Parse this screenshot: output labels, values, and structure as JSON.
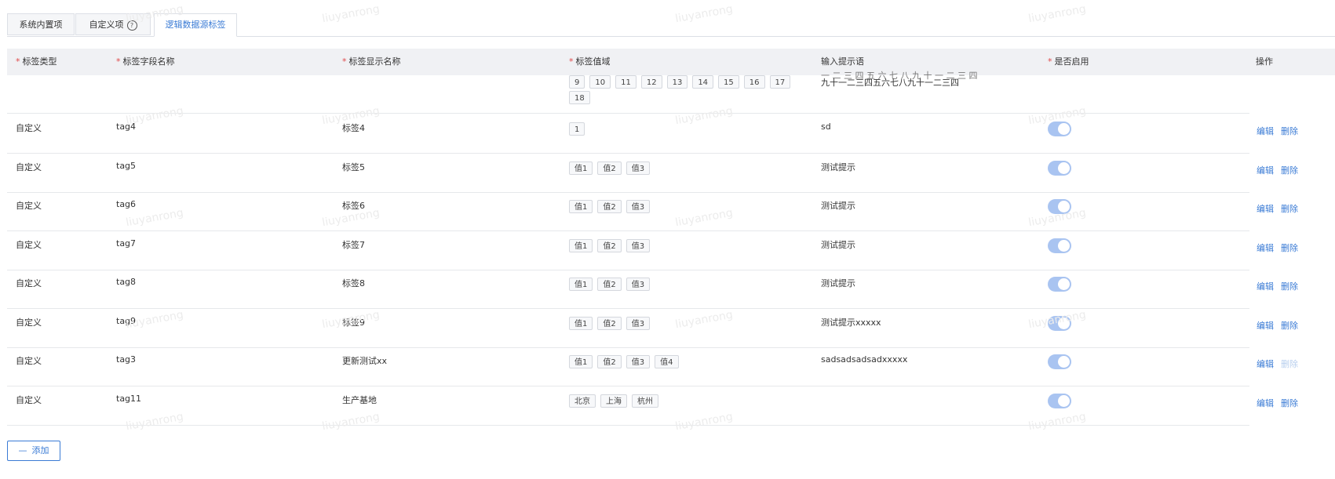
{
  "tabs": [
    {
      "label": "系统内置项",
      "active": false
    },
    {
      "label": "自定义项",
      "has_help_icon": true,
      "active": false
    },
    {
      "label": "逻辑数据源标签",
      "active": true
    }
  ],
  "columns": [
    {
      "label": "标签类型",
      "required": true
    },
    {
      "label": "标签字段名称",
      "required": true
    },
    {
      "label": "标签显示名称",
      "required": true
    },
    {
      "label": "标签值域",
      "required": true
    },
    {
      "label": "输入提示语",
      "required": false
    },
    {
      "label": "是否启用",
      "required": true
    },
    {
      "label": "操作",
      "required": false
    }
  ],
  "partial_row": {
    "values": [
      "9",
      "10",
      "11",
      "12",
      "13",
      "14",
      "15",
      "16",
      "17",
      "18"
    ],
    "hint_cut": "一 二 三 四 五 六 七 八 九 十 一 二 三 四",
    "hint": "九十一二三四五六七八九十一二三四"
  },
  "rows": [
    {
      "type": "自定义",
      "field": "tag4",
      "display": "标签4",
      "values": [
        "1"
      ],
      "hint": "sd",
      "enabled": true,
      "actions": {
        "edit": "编辑",
        "delete": "删除",
        "delete_disabled": false
      }
    },
    {
      "type": "自定义",
      "field": "tag5",
      "display": "标签5",
      "values": [
        "值1",
        "值2",
        "值3"
      ],
      "hint": "测试提示",
      "enabled": true,
      "actions": {
        "edit": "编辑",
        "delete": "删除",
        "delete_disabled": false
      }
    },
    {
      "type": "自定义",
      "field": "tag6",
      "display": "标签6",
      "values": [
        "值1",
        "值2",
        "值3"
      ],
      "hint": "测试提示",
      "enabled": true,
      "actions": {
        "edit": "编辑",
        "delete": "删除",
        "delete_disabled": false
      }
    },
    {
      "type": "自定义",
      "field": "tag7",
      "display": "标签7",
      "values": [
        "值1",
        "值2",
        "值3"
      ],
      "hint": "测试提示",
      "enabled": true,
      "actions": {
        "edit": "编辑",
        "delete": "删除",
        "delete_disabled": false
      }
    },
    {
      "type": "自定义",
      "field": "tag8",
      "display": "标签8",
      "values": [
        "值1",
        "值2",
        "值3"
      ],
      "hint": "测试提示",
      "enabled": true,
      "actions": {
        "edit": "编辑",
        "delete": "删除",
        "delete_disabled": false
      }
    },
    {
      "type": "自定义",
      "field": "tag9",
      "display": "标签9",
      "values": [
        "值1",
        "值2",
        "值3"
      ],
      "hint": "测试提示xxxxx",
      "enabled": true,
      "actions": {
        "edit": "编辑",
        "delete": "删除",
        "delete_disabled": false
      }
    },
    {
      "type": "自定义",
      "field": "tag3",
      "display": "更新测试xx",
      "values": [
        "值1",
        "值2",
        "值3",
        "值4"
      ],
      "hint": "sadsadsadsadxxxxx",
      "enabled": true,
      "actions": {
        "edit": "编辑",
        "delete": "删除",
        "delete_disabled": true
      }
    },
    {
      "type": "自定义",
      "field": "tag11",
      "display": "生产基地",
      "values": [
        "北京",
        "上海",
        "杭州"
      ],
      "hint": "",
      "enabled": true,
      "actions": {
        "edit": "编辑",
        "delete": "删除",
        "delete_disabled": false
      }
    }
  ],
  "add_button": {
    "icon": "minus-icon",
    "label": "添加"
  },
  "watermark": "liuyanrong",
  "colors": {
    "accent": "#3a7bd5",
    "required": "#e04a4a",
    "switch_on": "#a9c4f1",
    "header_bg": "#f0f1f4"
  }
}
